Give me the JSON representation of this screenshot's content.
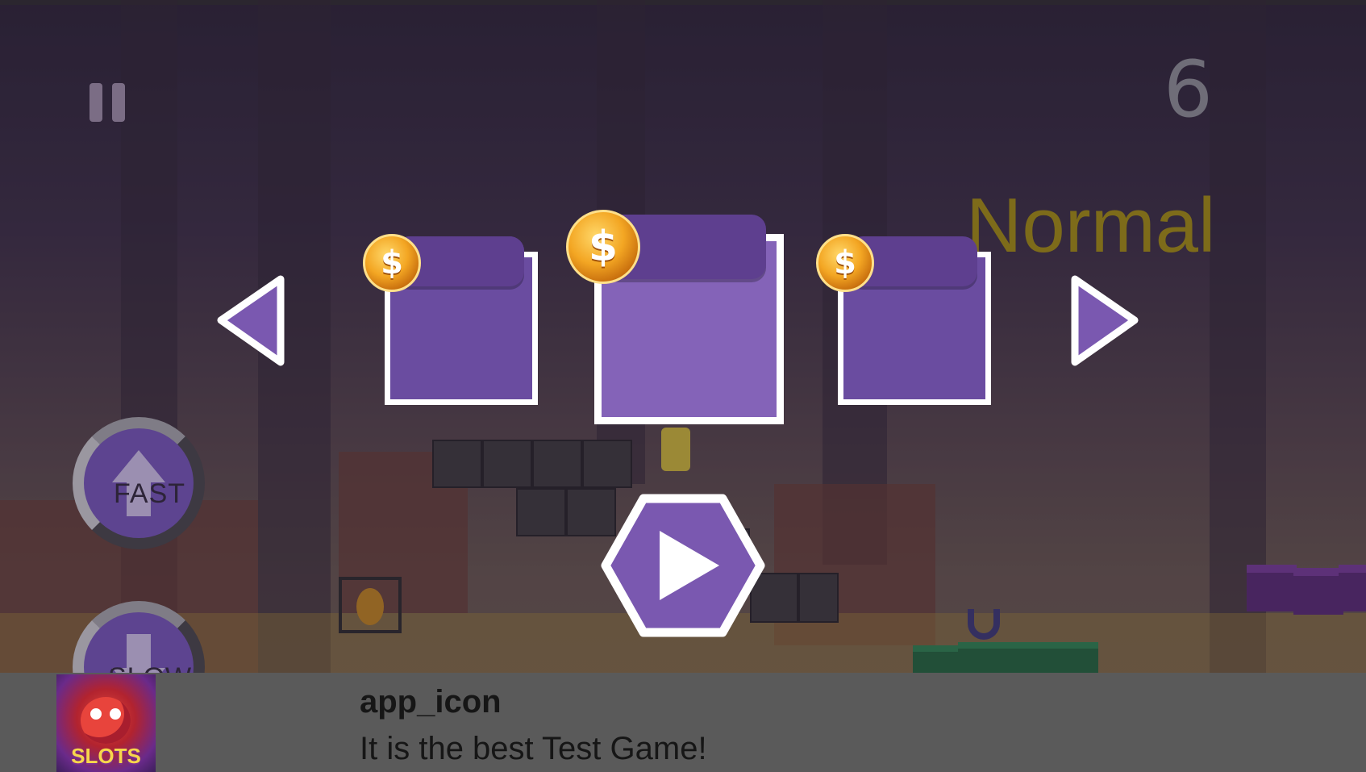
{
  "hud": {
    "score": "6",
    "difficulty": "Normal"
  },
  "controls": {
    "fast_label": "FAST",
    "slow_label": "SLOW"
  },
  "character_selector": {
    "coin_symbol": "$",
    "prev_icon": "left-triangle-icon",
    "next_icon": "right-triangle-icon",
    "play_icon": "play-icon"
  },
  "ad_banner": {
    "icon_text": "SLOTS",
    "title": "app_icon",
    "subtitle": "It is the best Test Game!"
  },
  "colors": {
    "accent_purple": "#8463b8",
    "card_purple": "#6a4ca0",
    "coin_gold": "#f3a623",
    "difficulty_text": "#7d6b1a"
  }
}
